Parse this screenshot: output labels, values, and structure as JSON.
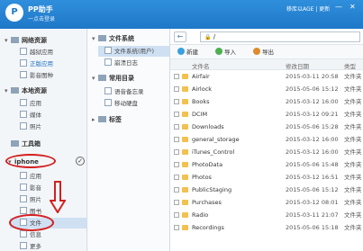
{
  "titlebar": {
    "logo": "P",
    "title": "PP助手",
    "subtitle": "一点击登录",
    "user": "移库以AGE | 更新",
    "min": "—",
    "close": "✕"
  },
  "sidebar": {
    "sections": [
      {
        "label": "网络资源",
        "arrow": "▾"
      },
      {
        "label": "本地资源",
        "arrow": "▾"
      },
      {
        "label": "工具箱",
        "arrow": ""
      }
    ],
    "net_items": [
      "越狱应用",
      "正版应用",
      "影音图种"
    ],
    "local_items": [
      "应用",
      "媒体",
      "照片"
    ],
    "device": {
      "name": "iphone",
      "arrow": "▾",
      "check": "✓"
    },
    "device_items": [
      "应用",
      "影音",
      "照片",
      "图书",
      "文件",
      "信息",
      "更多"
    ]
  },
  "tree": {
    "group1": {
      "label": "文件系统",
      "arrow": "▾"
    },
    "group1_items": [
      "文件系统(用户)",
      "崩溃日志"
    ],
    "group2": {
      "label": "常用目录",
      "arrow": "▾"
    },
    "group2_items": [
      "语音备忘录",
      "移动硬盘"
    ],
    "group3": {
      "label": "标签",
      "arrow": "▸"
    }
  },
  "address": {
    "back": "←",
    "lock": "🔒",
    "path": "/"
  },
  "toolbar": {
    "new": "新建",
    "import": "导入",
    "export": "导出"
  },
  "table": {
    "headers": {
      "name": "文件名",
      "date": "修改日期",
      "type": "类型"
    },
    "rows": [
      {
        "name": "Airfair",
        "date": "2015-03-11 20:58",
        "type": "文件夹"
      },
      {
        "name": "Airlock",
        "date": "2015-05-06 15:12",
        "type": "文件夹"
      },
      {
        "name": "Books",
        "date": "2015-03-12 16:00",
        "type": "文件夹"
      },
      {
        "name": "DCIM",
        "date": "2015-03-12 09:21",
        "type": "文件夹"
      },
      {
        "name": "Downloads",
        "date": "2015-05-06 15:28",
        "type": "文件夹"
      },
      {
        "name": "general_storage",
        "date": "2015-03-12 16:00",
        "type": "文件夹"
      },
      {
        "name": "iTunes_Control",
        "date": "2015-03-12 16:00",
        "type": "文件夹"
      },
      {
        "name": "PhotoData",
        "date": "2015-05-06 15:48",
        "type": "文件夹"
      },
      {
        "name": "Photos",
        "date": "2015-03-12 16:51",
        "type": "文件夹"
      },
      {
        "name": "PublicStaging",
        "date": "2015-05-06 15:12",
        "type": "文件夹"
      },
      {
        "name": "Purchases",
        "date": "2015-03-12 08:01",
        "type": "文件夹"
      },
      {
        "name": "Radio",
        "date": "2015-03-11 21:07",
        "type": "文件夹"
      },
      {
        "name": "Recordings",
        "date": "2015-05-06 15:18",
        "type": "文件夹"
      }
    ]
  },
  "colors": {
    "accent": "#1f78c8",
    "annotation": "#d32020",
    "folder": "#f2c14e"
  }
}
